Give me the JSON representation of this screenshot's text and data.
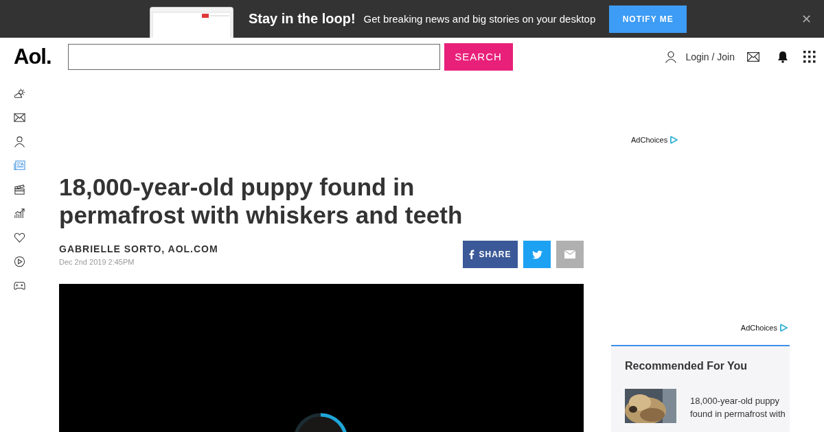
{
  "banner": {
    "title": "Stay in the loop!",
    "text": "Get breaking news and big stories on your desktop",
    "button": "NOTIFY ME",
    "close": "✕"
  },
  "header": {
    "logo": "Aol.",
    "search": {
      "button": "SEARCH"
    },
    "login": "Login / Join"
  },
  "nav_items": [
    {
      "kind": "weather",
      "selected": false
    },
    {
      "kind": "mail",
      "selected": false
    },
    {
      "kind": "user",
      "selected": false
    },
    {
      "kind": "news",
      "selected": true
    },
    {
      "kind": "video",
      "selected": false
    },
    {
      "kind": "finance",
      "selected": false
    },
    {
      "kind": "health",
      "selected": false
    },
    {
      "kind": "play",
      "selected": false
    },
    {
      "kind": "games",
      "selected": false
    }
  ],
  "article": {
    "title": "18,000-year-old puppy found in permafrost with whiskers and teeth",
    "author": "GABRIELLE SORTO, AOL.COM",
    "date": "Dec 2nd 2019 2:45PM",
    "share_button": "SHARE"
  },
  "ads": [
    {
      "label": "AdChoices"
    },
    {
      "label": "AdChoices"
    }
  ],
  "recommended": {
    "title": "Recommended For You",
    "items": [
      {
        "kind": "picture",
        "text": "18,000-year-old puppy found in permafrost with"
      }
    ]
  }
}
